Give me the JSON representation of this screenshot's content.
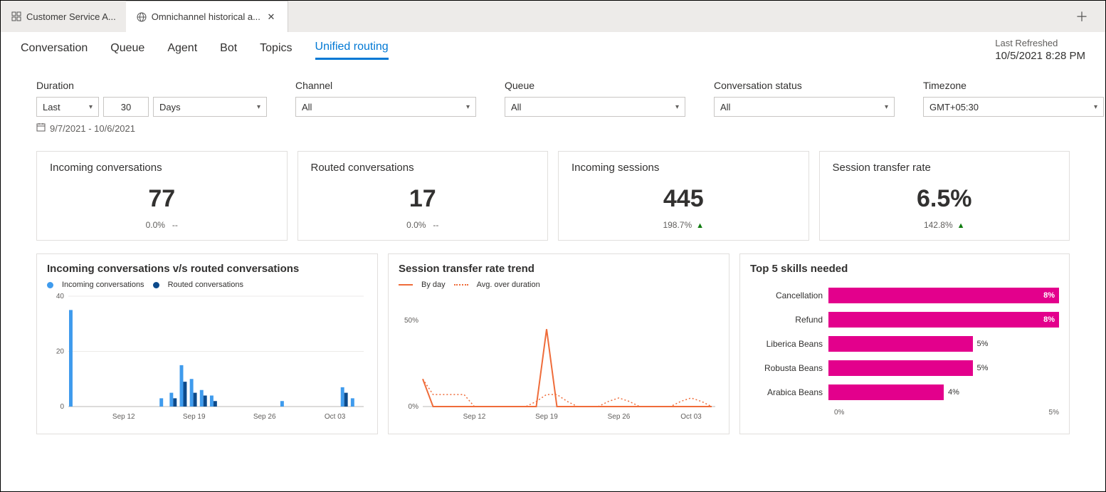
{
  "tabs": {
    "items": [
      {
        "label": "Customer Service A...",
        "active": false
      },
      {
        "label": "Omnichannel historical a...",
        "active": true
      }
    ]
  },
  "reportNav": {
    "items": [
      "Conversation",
      "Queue",
      "Agent",
      "Bot",
      "Topics",
      "Unified routing"
    ],
    "activeIndex": 5
  },
  "refresh": {
    "label": "Last Refreshed",
    "timestamp": "10/5/2021 8:28 PM"
  },
  "filters": {
    "duration": {
      "label": "Duration",
      "relative": "Last",
      "count": "30",
      "unit": "Days",
      "range": "9/7/2021 - 10/6/2021"
    },
    "channel": {
      "label": "Channel",
      "value": "All"
    },
    "queue": {
      "label": "Queue",
      "value": "All"
    },
    "status": {
      "label": "Conversation status",
      "value": "All"
    },
    "timezone": {
      "label": "Timezone",
      "value": "GMT+05:30"
    }
  },
  "kpis": [
    {
      "title": "Incoming conversations",
      "value": "77",
      "delta": "0.0%",
      "arrow": "--"
    },
    {
      "title": "Routed conversations",
      "value": "17",
      "delta": "0.0%",
      "arrow": "--"
    },
    {
      "title": "Incoming sessions",
      "value": "445",
      "delta": "198.7%",
      "arrow": "up"
    },
    {
      "title": "Session transfer rate",
      "value": "6.5%",
      "delta": "142.8%",
      "arrow": "up"
    }
  ],
  "chart_data": [
    {
      "type": "bar",
      "title": "Incoming conversations v/s routed conversations",
      "legend": [
        "Incoming conversations",
        "Routed conversations"
      ],
      "colors": [
        "#3f9bed",
        "#0c4a8b"
      ],
      "ylim": [
        0,
        40
      ],
      "yticks": [
        0,
        20,
        40
      ],
      "x_dates": [
        "Sep 07",
        "Sep 08",
        "Sep 09",
        "Sep 10",
        "Sep 11",
        "Sep 12",
        "Sep 13",
        "Sep 14",
        "Sep 15",
        "Sep 16",
        "Sep 17",
        "Sep 18",
        "Sep 19",
        "Sep 20",
        "Sep 21",
        "Sep 22",
        "Sep 23",
        "Sep 24",
        "Sep 25",
        "Sep 26",
        "Sep 27",
        "Sep 28",
        "Sep 29",
        "Sep 30",
        "Oct 01",
        "Oct 02",
        "Oct 03",
        "Oct 04",
        "Oct 05"
      ],
      "x_tick_labels": [
        "Sep 12",
        "Sep 19",
        "Sep 26",
        "Oct 03"
      ],
      "series": [
        {
          "name": "Incoming conversations",
          "values": [
            35,
            0,
            0,
            0,
            0,
            0,
            0,
            0,
            0,
            3,
            5,
            15,
            10,
            6,
            4,
            0,
            0,
            0,
            0,
            0,
            0,
            2,
            0,
            0,
            0,
            0,
            0,
            7,
            3
          ]
        },
        {
          "name": "Routed conversations",
          "values": [
            0,
            0,
            0,
            0,
            0,
            0,
            0,
            0,
            0,
            0,
            3,
            9,
            5,
            4,
            2,
            0,
            0,
            0,
            0,
            0,
            0,
            0,
            0,
            0,
            0,
            0,
            0,
            5,
            0
          ]
        }
      ]
    },
    {
      "type": "line",
      "title": "Session transfer rate trend",
      "legend": [
        "By day",
        "Avg. over duration"
      ],
      "colors": [
        "#ef6c3a",
        "#ef6c3a"
      ],
      "ylim": [
        0,
        60
      ],
      "yticks_labels": [
        "0%",
        "50%"
      ],
      "x_dates": [
        "Sep 07",
        "Sep 08",
        "Sep 09",
        "Sep 10",
        "Sep 11",
        "Sep 12",
        "Sep 13",
        "Sep 14",
        "Sep 15",
        "Sep 16",
        "Sep 17",
        "Sep 18",
        "Sep 19",
        "Sep 20",
        "Sep 21",
        "Sep 22",
        "Sep 23",
        "Sep 24",
        "Sep 25",
        "Sep 26",
        "Sep 27",
        "Sep 28",
        "Sep 29",
        "Sep 30",
        "Oct 01",
        "Oct 02",
        "Oct 03",
        "Oct 04",
        "Oct 05"
      ],
      "x_tick_labels": [
        "Sep 12",
        "Sep 19",
        "Sep 26",
        "Oct 03"
      ],
      "series": [
        {
          "name": "By day",
          "values": [
            16,
            0,
            0,
            0,
            0,
            0,
            0,
            0,
            0,
            0,
            0,
            0,
            45,
            0,
            0,
            0,
            0,
            0,
            0,
            0,
            0,
            0,
            0,
            0,
            0,
            0,
            0,
            0,
            0
          ]
        },
        {
          "name": "Avg. over duration",
          "values": [
            16,
            7,
            7,
            7,
            7,
            0,
            0,
            0,
            0,
            0,
            0,
            3,
            7,
            7,
            3,
            0,
            0,
            0,
            3,
            5,
            3,
            0,
            0,
            0,
            0,
            3,
            5,
            3,
            0
          ]
        }
      ]
    },
    {
      "type": "bar",
      "title": "Top 5 skills needed",
      "orientation": "horizontal",
      "xlim": [
        0,
        8
      ],
      "xticks_labels": [
        "0%",
        "5%"
      ],
      "color": "#e3008c",
      "categories": [
        "Cancellation",
        "Refund",
        "Liberica Beans",
        "Robusta Beans",
        "Arabica Beans"
      ],
      "values": [
        8,
        8,
        5,
        5,
        4
      ],
      "value_labels": [
        "8%",
        "8%",
        "5%",
        "5%",
        "4%"
      ]
    }
  ]
}
